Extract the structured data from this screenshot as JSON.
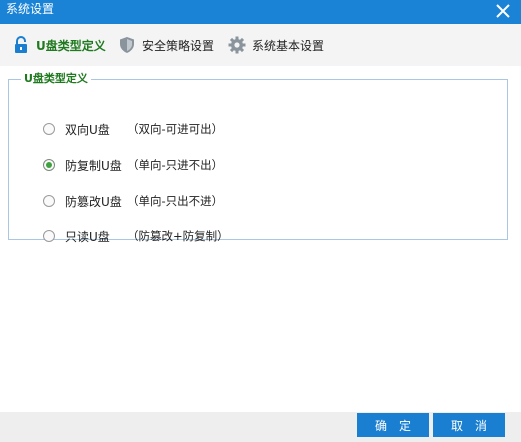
{
  "window": {
    "title": "系统设置",
    "close_icon": "close-icon"
  },
  "tabs": [
    {
      "label": "U盘类型定义",
      "icon": "lock-icon",
      "active": true
    },
    {
      "label": "安全策略设置",
      "icon": "shield-icon",
      "active": false
    },
    {
      "label": "系统基本设置",
      "icon": "gear-icon",
      "active": false
    }
  ],
  "group": {
    "title": "U盘类型定义",
    "options": [
      {
        "label": "双向U盘",
        "desc": "（双向-可进可出）",
        "checked": false
      },
      {
        "label": "防复制U盘",
        "desc": "（单向-只进不出）",
        "checked": true
      },
      {
        "label": "防篡改U盘",
        "desc": "（单向-只出不进）",
        "checked": false
      },
      {
        "label": "只读U盘",
        "desc": "（防篡改+防复制）",
        "checked": false
      }
    ]
  },
  "footer": {
    "ok_label": "确定",
    "cancel_label": "取消"
  },
  "colors": {
    "title_bar": "#1a83d6",
    "active_tab_text": "#1f7a1f",
    "button": "#1a7fd0",
    "radio_checked": "#3fa13f"
  }
}
